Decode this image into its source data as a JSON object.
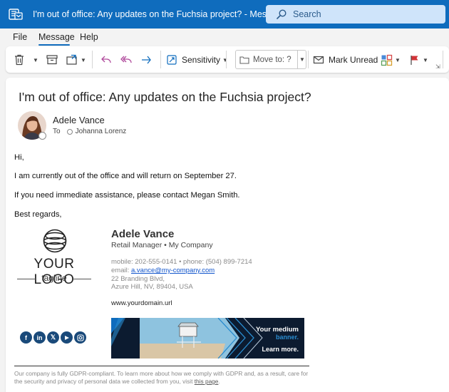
{
  "window": {
    "title": "I'm out of office: Any updates on the Fuchsia project?  -  Message (HTML)",
    "search_placeholder": "Search"
  },
  "menu": {
    "items": [
      "File",
      "Message",
      "Help"
    ],
    "active": "Message"
  },
  "ribbon": {
    "sensitivity_label": "Sensitivity",
    "move_to_label": "Move to: ?",
    "mark_unread_label": "Mark Unread"
  },
  "message": {
    "subject": "I'm out of office: Any updates on the Fuchsia project?",
    "sender": "Adele Vance",
    "to_label": "To",
    "recipient": "Johanna Lorenz",
    "body": {
      "greeting": "Hi,",
      "line1": "I am currently out of the office and will return on September 27.",
      "line2": "If you need immediate assistance, please contact Megan Smith.",
      "closing": "Best regards,"
    }
  },
  "signature": {
    "logo_text": "YOUR LOGO",
    "logo_tagline": "tagline",
    "name": "Adele Vance",
    "role": "Retail Manager • My Company",
    "phones": "mobile: 202-555-0141 • phone: (504) 899-7214",
    "email_label": "email:",
    "email": "a.vance@my-company.com",
    "address1": "22 Branding Blvd,",
    "address2": "Azure Hill, NV, 89404, USA",
    "website": "www.yourdomain.url",
    "social_icons": [
      "facebook-icon",
      "linkedin-icon",
      "x-icon",
      "youtube-icon",
      "instagram-icon"
    ],
    "banner": {
      "line1": "Your medium",
      "line2": "banner.",
      "line3": "Learn more."
    },
    "footer_text": "Our company is fully GDPR-compliant. To learn more about how we comply with GDPR and, as a result, care for the security and privacy of personal data we collected from you, visit",
    "footer_link": "this page",
    "footer_end": "."
  },
  "colors": {
    "titlebar": "#0f6cbd",
    "accent": "#0f6cbd",
    "social": "#1a4a7a",
    "banner_accent": "#2a8ccf"
  }
}
